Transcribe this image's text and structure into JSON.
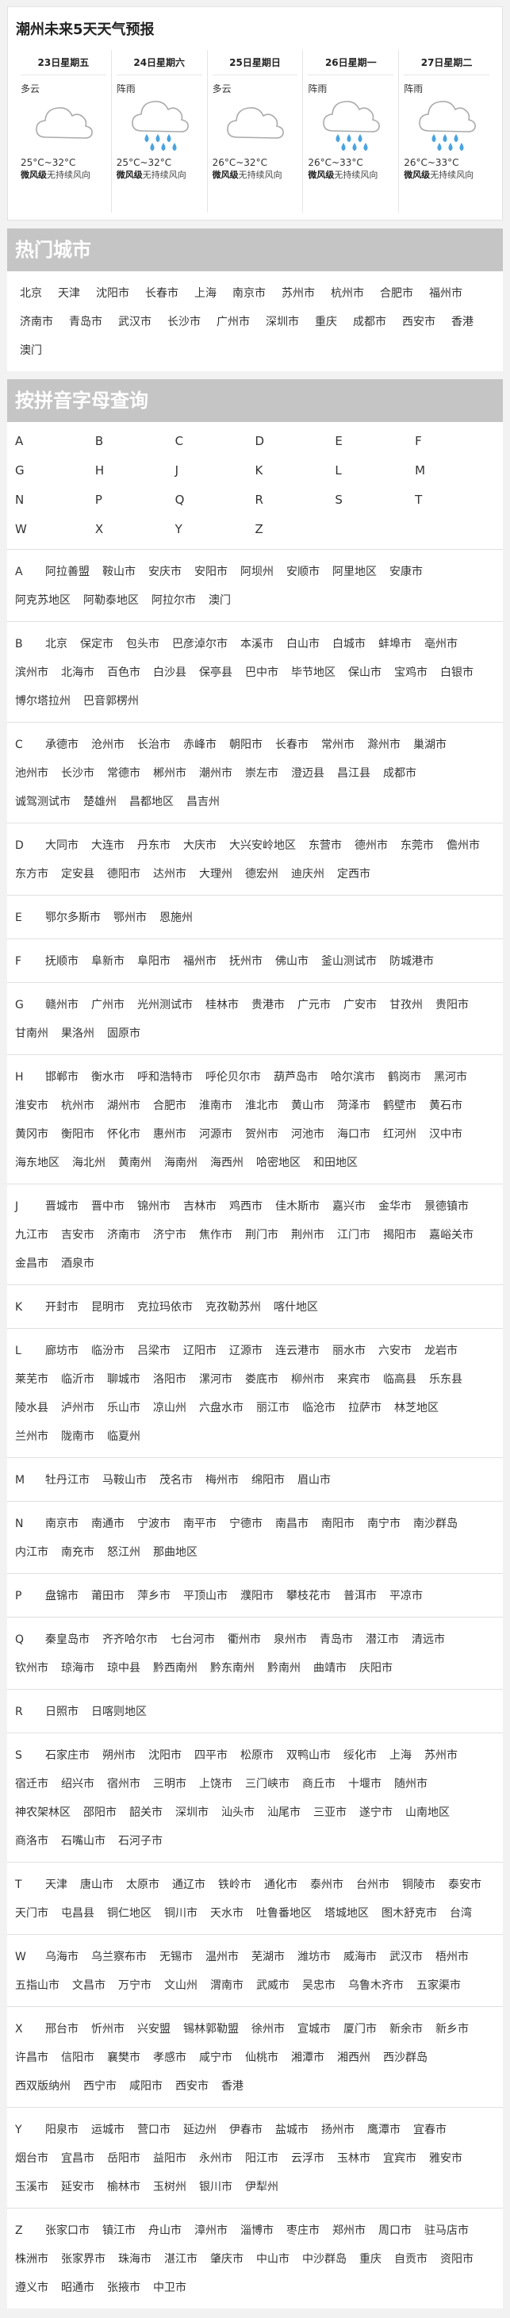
{
  "forecast": {
    "title": "潮州未来5天天气预报",
    "days": [
      {
        "date": "23日星期五",
        "cond": "多云",
        "icon": "cloud-icon",
        "temp": "25°C~32°C",
        "wind_level": "微风级",
        "wind_dir": "无持续风向"
      },
      {
        "date": "24日星期六",
        "cond": "阵雨",
        "icon": "rain-icon",
        "temp": "25°C~32°C",
        "wind_level": "微风级",
        "wind_dir": "无持续风向"
      },
      {
        "date": "25日星期日",
        "cond": "多云",
        "icon": "cloud-icon",
        "temp": "26°C~32°C",
        "wind_level": "微风级",
        "wind_dir": "无持续风向"
      },
      {
        "date": "26日星期一",
        "cond": "阵雨",
        "icon": "rain-icon",
        "temp": "26°C~33°C",
        "wind_level": "微风级",
        "wind_dir": "无持续风向"
      },
      {
        "date": "27日星期二",
        "cond": "阵雨",
        "icon": "rain-icon",
        "temp": "26°C~33°C",
        "wind_level": "微风级",
        "wind_dir": "无持续风向"
      }
    ]
  },
  "hot": {
    "title": "热门城市",
    "cities": [
      "北京",
      "天津",
      "沈阳市",
      "长春市",
      "上海",
      "南京市",
      "苏州市",
      "杭州市",
      "合肥市",
      "福州市",
      "济南市",
      "青岛市",
      "武汉市",
      "长沙市",
      "广州市",
      "深圳市",
      "重庆",
      "成都市",
      "西安市",
      "香港",
      "澳门"
    ]
  },
  "pinyin": {
    "title": "按拼音字母查询",
    "letters": [
      "A",
      "B",
      "C",
      "D",
      "E",
      "F",
      "G",
      "H",
      "J",
      "K",
      "L",
      "M",
      "N",
      "P",
      "Q",
      "R",
      "S",
      "T",
      "W",
      "X",
      "Y",
      "Z"
    ],
    "groups": [
      {
        "letter": "A",
        "cities": [
          "阿拉善盟",
          "鞍山市",
          "安庆市",
          "安阳市",
          "阿坝州",
          "安顺市",
          "阿里地区",
          "安康市",
          "阿克苏地区",
          "阿勒泰地区",
          "阿拉尔市",
          "澳门"
        ]
      },
      {
        "letter": "B",
        "cities": [
          "北京",
          "保定市",
          "包头市",
          "巴彦淖尔市",
          "本溪市",
          "白山市",
          "白城市",
          "蚌埠市",
          "亳州市",
          "滨州市",
          "北海市",
          "百色市",
          "白沙县",
          "保亭县",
          "巴中市",
          "毕节地区",
          "保山市",
          "宝鸡市",
          "白银市",
          "博尔塔拉州",
          "巴音郭楞州"
        ]
      },
      {
        "letter": "C",
        "cities": [
          "承德市",
          "沧州市",
          "长治市",
          "赤峰市",
          "朝阳市",
          "长春市",
          "常州市",
          "滁州市",
          "巢湖市",
          "池州市",
          "长沙市",
          "常德市",
          "郴州市",
          "潮州市",
          "崇左市",
          "澄迈县",
          "昌江县",
          "成都市",
          "诚驾测试市",
          "楚雄州",
          "昌都地区",
          "昌吉州"
        ]
      },
      {
        "letter": "D",
        "cities": [
          "大同市",
          "大连市",
          "丹东市",
          "大庆市",
          "大兴安岭地区",
          "东营市",
          "德州市",
          "东莞市",
          "儋州市",
          "东方市",
          "定安县",
          "德阳市",
          "达州市",
          "大理州",
          "德宏州",
          "迪庆州",
          "定西市"
        ]
      },
      {
        "letter": "E",
        "cities": [
          "鄂尔多斯市",
          "鄂州市",
          "恩施州"
        ]
      },
      {
        "letter": "F",
        "cities": [
          "抚顺市",
          "阜新市",
          "阜阳市",
          "福州市",
          "抚州市",
          "佛山市",
          "釜山测试市",
          "防城港市"
        ]
      },
      {
        "letter": "G",
        "cities": [
          "赣州市",
          "广州市",
          "光州测试市",
          "桂林市",
          "贵港市",
          "广元市",
          "广安市",
          "甘孜州",
          "贵阳市",
          "甘南州",
          "果洛州",
          "固原市"
        ]
      },
      {
        "letter": "H",
        "cities": [
          "邯郸市",
          "衡水市",
          "呼和浩特市",
          "呼伦贝尔市",
          "葫芦岛市",
          "哈尔滨市",
          "鹤岗市",
          "黑河市",
          "淮安市",
          "杭州市",
          "湖州市",
          "合肥市",
          "淮南市",
          "淮北市",
          "黄山市",
          "菏泽市",
          "鹤壁市",
          "黄石市",
          "黄冈市",
          "衡阳市",
          "怀化市",
          "惠州市",
          "河源市",
          "贺州市",
          "河池市",
          "海口市",
          "红河州",
          "汉中市",
          "海东地区",
          "海北州",
          "黄南州",
          "海南州",
          "海西州",
          "哈密地区",
          "和田地区"
        ]
      },
      {
        "letter": "J",
        "cities": [
          "晋城市",
          "晋中市",
          "锦州市",
          "吉林市",
          "鸡西市",
          "佳木斯市",
          "嘉兴市",
          "金华市",
          "景德镇市",
          "九江市",
          "吉安市",
          "济南市",
          "济宁市",
          "焦作市",
          "荆门市",
          "荆州市",
          "江门市",
          "揭阳市",
          "嘉峪关市",
          "金昌市",
          "酒泉市"
        ]
      },
      {
        "letter": "K",
        "cities": [
          "开封市",
          "昆明市",
          "克拉玛依市",
          "克孜勒苏州",
          "喀什地区"
        ]
      },
      {
        "letter": "L",
        "cities": [
          "廊坊市",
          "临汾市",
          "吕梁市",
          "辽阳市",
          "辽源市",
          "连云港市",
          "丽水市",
          "六安市",
          "龙岩市",
          "莱芜市",
          "临沂市",
          "聊城市",
          "洛阳市",
          "漯河市",
          "娄底市",
          "柳州市",
          "来宾市",
          "临高县",
          "乐东县",
          "陵水县",
          "泸州市",
          "乐山市",
          "凉山州",
          "六盘水市",
          "丽江市",
          "临沧市",
          "拉萨市",
          "林芝地区",
          "兰州市",
          "陇南市",
          "临夏州"
        ]
      },
      {
        "letter": "M",
        "cities": [
          "牡丹江市",
          "马鞍山市",
          "茂名市",
          "梅州市",
          "绵阳市",
          "眉山市"
        ]
      },
      {
        "letter": "N",
        "cities": [
          "南京市",
          "南通市",
          "宁波市",
          "南平市",
          "宁德市",
          "南昌市",
          "南阳市",
          "南宁市",
          "南沙群岛",
          "内江市",
          "南充市",
          "怒江州",
          "那曲地区"
        ]
      },
      {
        "letter": "P",
        "cities": [
          "盘锦市",
          "莆田市",
          "萍乡市",
          "平顶山市",
          "濮阳市",
          "攀枝花市",
          "普洱市",
          "平凉市"
        ]
      },
      {
        "letter": "Q",
        "cities": [
          "秦皇岛市",
          "齐齐哈尔市",
          "七台河市",
          "衢州市",
          "泉州市",
          "青岛市",
          "潜江市",
          "清远市",
          "钦州市",
          "琼海市",
          "琼中县",
          "黔西南州",
          "黔东南州",
          "黔南州",
          "曲靖市",
          "庆阳市"
        ]
      },
      {
        "letter": "R",
        "cities": [
          "日照市",
          "日喀则地区"
        ]
      },
      {
        "letter": "S",
        "cities": [
          "石家庄市",
          "朔州市",
          "沈阳市",
          "四平市",
          "松原市",
          "双鸭山市",
          "绥化市",
          "上海",
          "苏州市",
          "宿迁市",
          "绍兴市",
          "宿州市",
          "三明市",
          "上饶市",
          "三门峡市",
          "商丘市",
          "十堰市",
          "随州市",
          "神农架林区",
          "邵阳市",
          "韶关市",
          "深圳市",
          "汕头市",
          "汕尾市",
          "三亚市",
          "遂宁市",
          "山南地区",
          "商洛市",
          "石嘴山市",
          "石河子市"
        ]
      },
      {
        "letter": "T",
        "cities": [
          "天津",
          "唐山市",
          "太原市",
          "通辽市",
          "铁岭市",
          "通化市",
          "泰州市",
          "台州市",
          "铜陵市",
          "泰安市",
          "天门市",
          "屯昌县",
          "铜仁地区",
          "铜川市",
          "天水市",
          "吐鲁番地区",
          "塔城地区",
          "图木舒克市",
          "台湾"
        ]
      },
      {
        "letter": "W",
        "cities": [
          "乌海市",
          "乌兰察布市",
          "无锡市",
          "温州市",
          "芜湖市",
          "潍坊市",
          "威海市",
          "武汉市",
          "梧州市",
          "五指山市",
          "文昌市",
          "万宁市",
          "文山州",
          "渭南市",
          "武威市",
          "吴忠市",
          "乌鲁木齐市",
          "五家渠市"
        ]
      },
      {
        "letter": "X",
        "cities": [
          "邢台市",
          "忻州市",
          "兴安盟",
          "锡林郭勒盟",
          "徐州市",
          "宣城市",
          "厦门市",
          "新余市",
          "新乡市",
          "许昌市",
          "信阳市",
          "襄樊市",
          "孝感市",
          "咸宁市",
          "仙桃市",
          "湘潭市",
          "湘西州",
          "西沙群岛",
          "西双版纳州",
          "西宁市",
          "咸阳市",
          "西安市",
          "香港"
        ]
      },
      {
        "letter": "Y",
        "cities": [
          "阳泉市",
          "运城市",
          "营口市",
          "延边州",
          "伊春市",
          "盐城市",
          "扬州市",
          "鹰潭市",
          "宜春市",
          "烟台市",
          "宜昌市",
          "岳阳市",
          "益阳市",
          "永州市",
          "阳江市",
          "云浮市",
          "玉林市",
          "宜宾市",
          "雅安市",
          "玉溪市",
          "延安市",
          "榆林市",
          "玉树州",
          "银川市",
          "伊犁州"
        ]
      },
      {
        "letter": "Z",
        "cities": [
          "张家口市",
          "镇江市",
          "舟山市",
          "漳州市",
          "淄博市",
          "枣庄市",
          "郑州市",
          "周口市",
          "驻马店市",
          "株洲市",
          "张家界市",
          "珠海市",
          "湛江市",
          "肇庆市",
          "中山市",
          "中沙群岛",
          "重庆",
          "自贡市",
          "资阳市",
          "遵义市",
          "昭通市",
          "张掖市",
          "中卫市"
        ]
      }
    ]
  }
}
